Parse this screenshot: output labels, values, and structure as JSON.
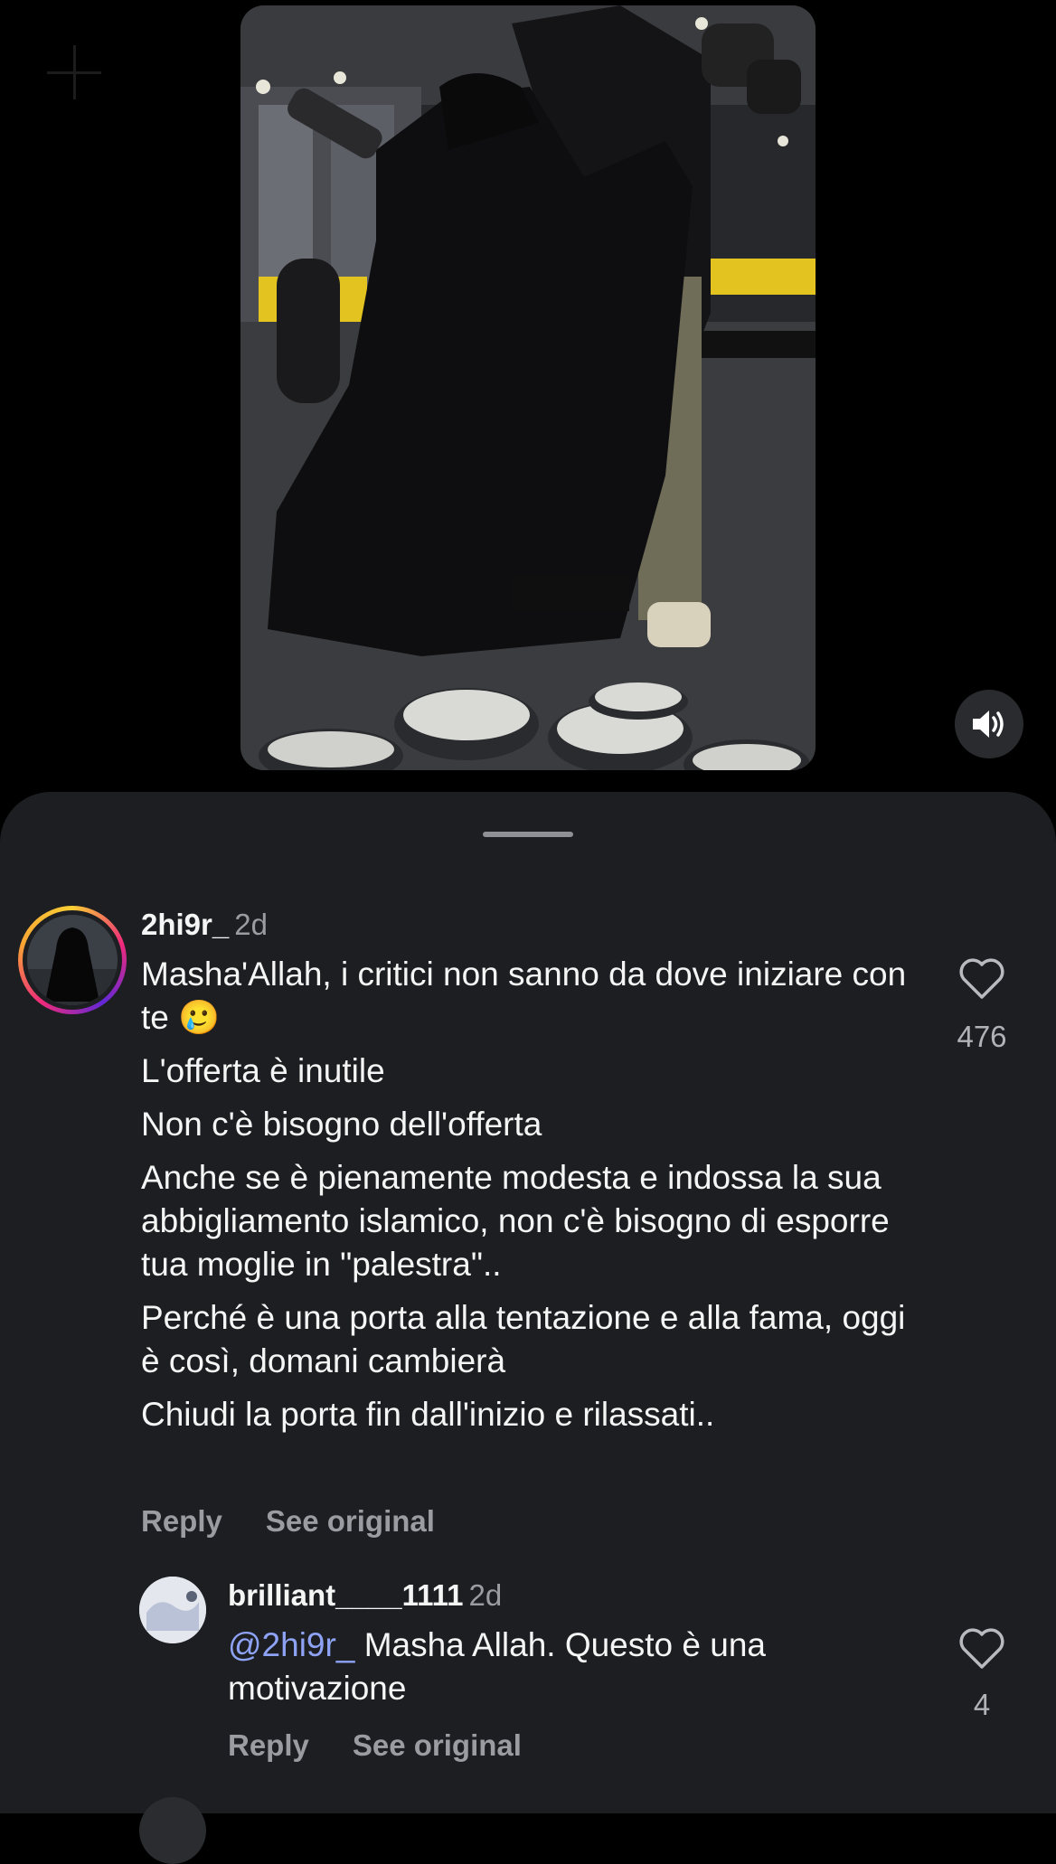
{
  "video": {
    "mute_icon": "speaker-icon"
  },
  "comments": [
    {
      "username": "2hi9r_",
      "time": "2d",
      "paragraphs": [
        "Masha'Allah, i critici non sanno da dove iniziare con te 🥲",
        "L'offerta è inutile",
        "Non c'è bisogno dell'offerta",
        "Anche se è pienamente modesta e indossa la sua abbigliamento islamico, non c'è bisogno di esporre tua moglie in \"palestra\"..",
        "Perché è una porta alla tentazione e alla fama, oggi è così, domani cambierà",
        "Chiudi la porta fin dall'inizio e rilassati.."
      ],
      "likes": "476",
      "reply_label": "Reply",
      "see_original_label": "See original"
    },
    {
      "username": "brilliant____1111",
      "time": "2d",
      "mention": "@2hi9r_",
      "text": "Masha Allah. Questo è una motivazione",
      "likes": "4",
      "reply_label": "Reply",
      "see_original_label": "See original"
    }
  ]
}
